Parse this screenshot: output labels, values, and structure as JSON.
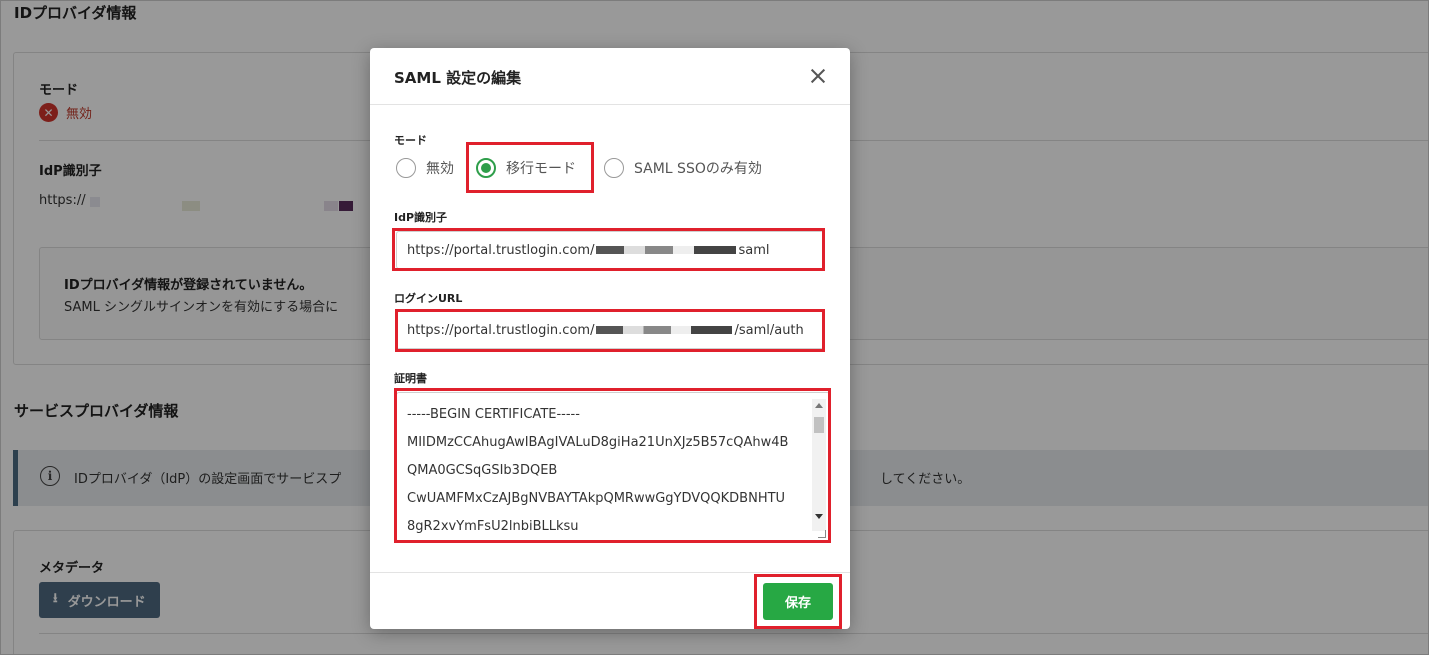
{
  "idp_section": {
    "title": "IDプロバイダ情報",
    "mode_label": "モード",
    "mode_value": "無効",
    "idp_id_label": "IdP識別子",
    "idp_id_value": "https://",
    "notice_title": "IDプロバイダ情報が登録されていません。",
    "notice_body": "SAML シングルサインオンを有効にする場合に"
  },
  "sp_section": {
    "title": "サービスプロバイダ情報",
    "alert_left": "IDプロバイダ（IdP）の設定画面でサービスプ",
    "alert_right": "してください。",
    "metadata_label": "メタデータ",
    "download_label": "ダウンロード"
  },
  "modal": {
    "title": "SAML 設定の編集",
    "mode_label": "モード",
    "radio_options": [
      "無効",
      "移行モード",
      "SAML SSOのみ有効"
    ],
    "selected_option": "移行モード",
    "idp_id_label": "IdP識別子",
    "idp_id_prefix": "https://portal.trustlogin.com/",
    "idp_id_suffix": "saml",
    "login_url_label": "ログインURL",
    "login_url_prefix": "https://portal.trustlogin.com/",
    "login_url_suffix": "/saml/auth",
    "cert_label": "証明書",
    "cert_lines": [
      "-----BEGIN CERTIFICATE-----",
      "MIIDMzCCAhugAwIBAgIVALuD8giHa21UnXJz5B57cQAhw4B",
      "QMA0GCSqGSIb3DQEB",
      "CwUAMFMxCzAJBgNVBAYTAkpQMRwwGgYDVQQKDBNHTU",
      "8gR2xvYmFsU2lnbiBLLksu"
    ],
    "save_label": "保存"
  },
  "colors": {
    "accent_green": "#27a844",
    "highlight_red": "#e0202c",
    "error_red": "#d0342c",
    "button_slate": "#4f6a80"
  }
}
